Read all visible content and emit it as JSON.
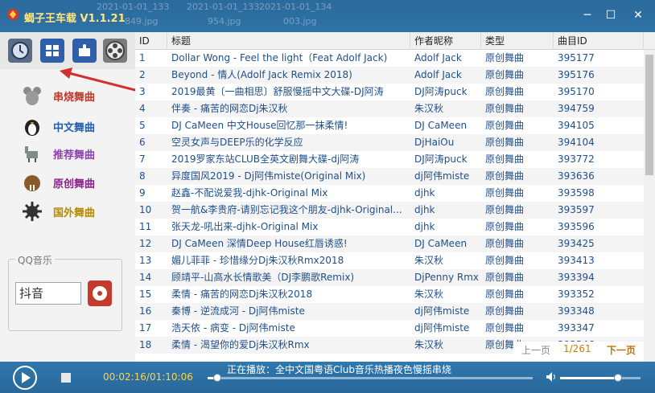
{
  "app": {
    "title": "蝎子王车载 V1.1.21"
  },
  "ghost_text": [
    "2021-01-01_133",
    "2021-01-01_133",
    "2021-01-01_134",
    "849.jpg",
    "954.jpg",
    "003.jpg"
  ],
  "window_controls": {
    "minimize": "─",
    "maximize": "☐",
    "close": "✕"
  },
  "top_icons": [
    "clock-icon",
    "grid-icon",
    "puzzle-icon",
    "film-reel-icon"
  ],
  "categories": [
    {
      "label": "串烧舞曲",
      "icon": "mouse-icon",
      "color": "#c0392b"
    },
    {
      "label": "中文舞曲",
      "icon": "penguin-icon",
      "color": "#1f5fb0"
    },
    {
      "label": "推荐舞曲",
      "icon": "donkey-icon",
      "color": "#8e44ad"
    },
    {
      "label": "原创舞曲",
      "icon": "walrus-icon",
      "color": "#8e1f8e"
    },
    {
      "label": "国外舞曲",
      "icon": "gear-flower-icon",
      "color": "#b88a00"
    }
  ],
  "qq": {
    "legend": "QQ音乐",
    "input_value": "抖音"
  },
  "table": {
    "columns": [
      "ID",
      "标题",
      "作者昵称",
      "类型",
      "曲目ID"
    ],
    "rows": [
      {
        "id": "1",
        "title": "Dollar Wong - Feel the light（Feat Adolf Jack)",
        "author": "Adolf Jack",
        "type": "原创舞曲",
        "song_id": "395177"
      },
      {
        "id": "2",
        "title": "Beyond - 情人(Adolf Jack Remix 2018)",
        "author": "Adolf Jack",
        "type": "原创舞曲",
        "song_id": "395176"
      },
      {
        "id": "3",
        "title": "2019最黄〔一曲相思〕舒服慢摇中文大碟-DJ阿涛",
        "author": "DJ阿涛puck",
        "type": "原创舞曲",
        "song_id": "395170"
      },
      {
        "id": "4",
        "title": "伴奏 - 痛苦的网恋Dj朱汉秋",
        "author": "朱汉秋",
        "type": "原创舞曲",
        "song_id": "394759"
      },
      {
        "id": "5",
        "title": "DJ CaMeen 中文House回忆那一抹柔情!",
        "author": "DJ CaMeen",
        "type": "原创舞曲",
        "song_id": "394105"
      },
      {
        "id": "6",
        "title": "空灵女声与DEEP乐的化学反应",
        "author": "DjHaiOu",
        "type": "原创舞曲",
        "song_id": "394104"
      },
      {
        "id": "7",
        "title": "2019罗家东站CLUB全英文剧舞大碟-dj阿涛",
        "author": "DJ阿涛puck",
        "type": "原创舞曲",
        "song_id": "393772"
      },
      {
        "id": "8",
        "title": "异度国风2019 - Dj阿伟miste(Original Mix)",
        "author": "dj阿伟miste",
        "type": "原创舞曲",
        "song_id": "393636"
      },
      {
        "id": "9",
        "title": "赵鑫-不配说爱我-djhk-Original Mix",
        "author": "djhk",
        "type": "原创舞曲",
        "song_id": "393598"
      },
      {
        "id": "10",
        "title": "贺一航&李贵府-请别忘记我这个朋友-djhk-Original...",
        "author": "djhk",
        "type": "原创舞曲",
        "song_id": "393597"
      },
      {
        "id": "11",
        "title": "张天龙-吼出来-djhk-Original Mix",
        "author": "djhk",
        "type": "原创舞曲",
        "song_id": "393596"
      },
      {
        "id": "12",
        "title": "DJ CaMeen 深情Deep House红唇诱惑!",
        "author": "DJ CaMeen",
        "type": "原创舞曲",
        "song_id": "393425"
      },
      {
        "id": "13",
        "title": "媚儿菲菲 - 珍惜缘分Dj朱汉秋Rmx2018",
        "author": "朱汉秋",
        "type": "原创舞曲",
        "song_id": "393413"
      },
      {
        "id": "14",
        "title": "顾靖平-山高水长情歌美（DJ李鹏歌Remix)",
        "author": "DjPenny Rmx",
        "type": "原创舞曲",
        "song_id": "393394"
      },
      {
        "id": "15",
        "title": "柔情 - 痛苦的网恋Dj朱汉秋2018",
        "author": "朱汉秋",
        "type": "原创舞曲",
        "song_id": "393352"
      },
      {
        "id": "16",
        "title": "秦博 - 逆流成河 - Dj阿伟miste",
        "author": "dj阿伟miste",
        "type": "原创舞曲",
        "song_id": "393348"
      },
      {
        "id": "17",
        "title": "浩天依 - 病变 - Dj阿伟miste",
        "author": "dj阿伟miste",
        "type": "原创舞曲",
        "song_id": "393347"
      },
      {
        "id": "18",
        "title": "柔情 - 渴望你的爱Dj朱汉秋Rmx",
        "author": "朱汉秋",
        "type": "原创舞曲",
        "song_id": "393346"
      }
    ]
  },
  "pager": {
    "prev": "上一页",
    "page": "1/261",
    "next": "下一页"
  },
  "player": {
    "time": "00:02:16/01:10:06",
    "now_playing": "正在播放：全中文国粤语Club音乐热播夜色慢摇串烧",
    "progress": 0.03,
    "volume": 0.72
  },
  "colors": {
    "accent": "#2f72a6",
    "title_text": "#ffe680",
    "time_text": "#ffd34a",
    "row_text": "#1f4f8a"
  }
}
